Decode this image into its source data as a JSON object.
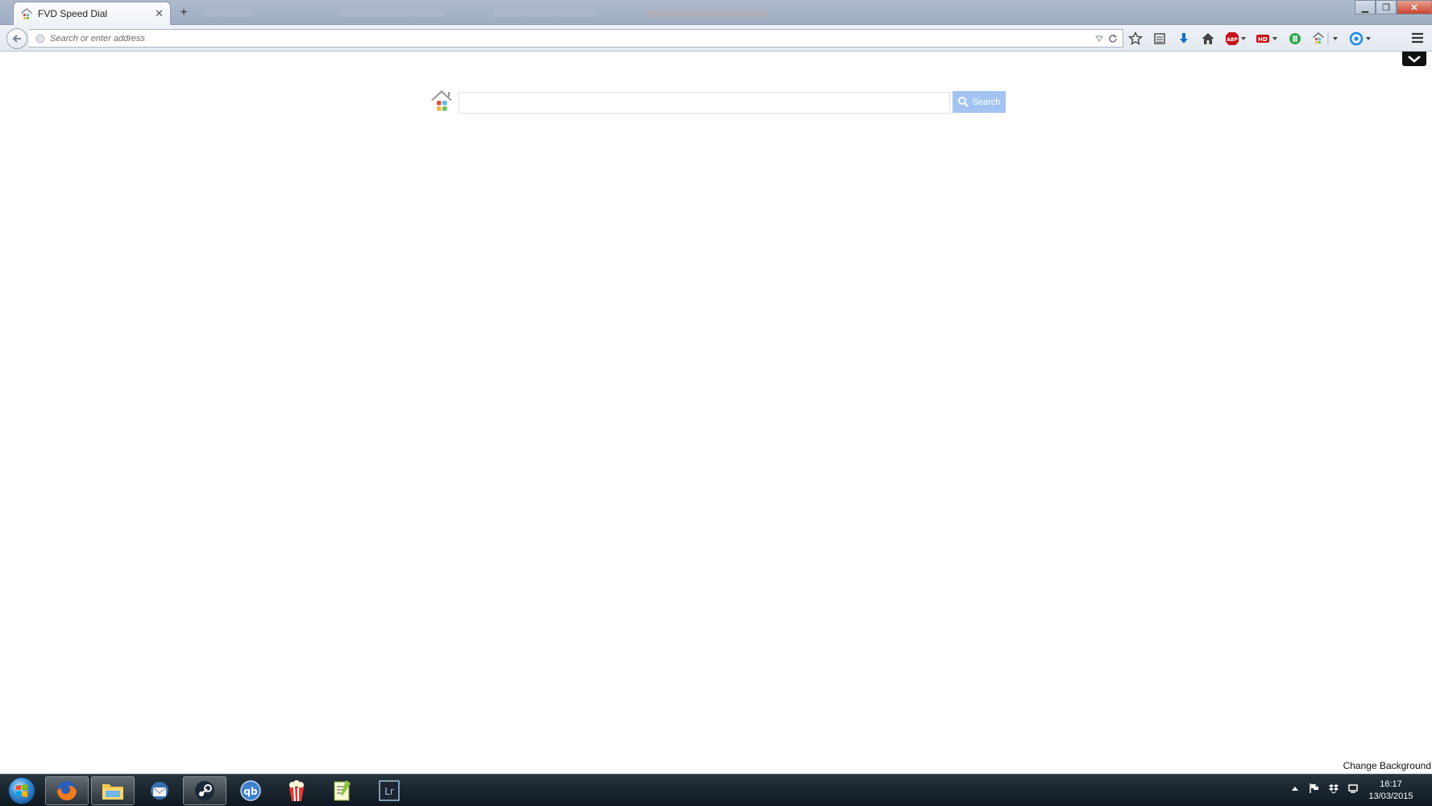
{
  "browser": {
    "tabs": [
      {
        "title": "FVD Speed Dial",
        "active": true
      }
    ],
    "url_placeholder": "Search or enter address",
    "toolbar_icons": [
      "bookmark-star-icon",
      "reading-list-icon",
      "download-arrow-icon",
      "home-icon",
      "adblock-plus-icon",
      "hd-extension-icon",
      "green-extension-icon",
      "speed-dial-icon",
      "sync-icon"
    ],
    "colors": {
      "accent": "#a3c4f2",
      "download": "#1a6fc9",
      "adblock": "#c6131b"
    }
  },
  "page": {
    "search_button_label": "Search",
    "search_placeholder": "",
    "footer_link": "Change Background"
  },
  "taskbar": {
    "apps": [
      "firefox",
      "file-explorer",
      "thunderbird",
      "steam",
      "qbittorrent",
      "popcorn-time",
      "notepad-plus",
      "lightroom"
    ],
    "clock_time": "16:17",
    "clock_date": "13/03/2015"
  }
}
